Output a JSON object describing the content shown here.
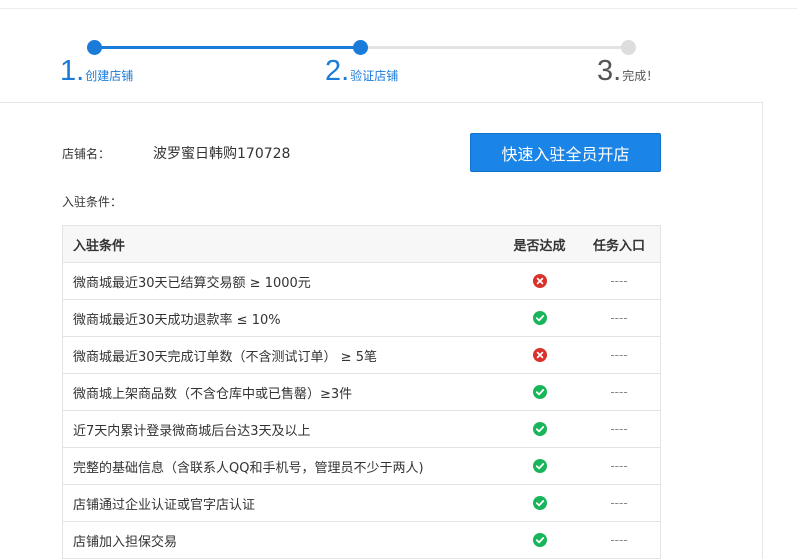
{
  "stepper": {
    "steps": [
      {
        "number": "1.",
        "label": "创建店铺",
        "state": "done"
      },
      {
        "number": "2.",
        "label": "验证店铺",
        "state": "current"
      },
      {
        "number": "3.",
        "label": "完成！",
        "state": "pending"
      }
    ]
  },
  "shop": {
    "name_label": "店铺名：",
    "name_value": "波罗蜜日韩购170728"
  },
  "open_button": {
    "label": "快速入驻全员开店"
  },
  "conditions": {
    "caption": "入驻条件：",
    "columns": [
      "入驻条件",
      "是否达成",
      "任务入口"
    ],
    "rows": [
      {
        "condition": "微商城最近30天已结算交易额 ≥ 1000元",
        "met": false,
        "status_icon": "x-circle-icon",
        "entry": "----"
      },
      {
        "condition": "微商城最近30天成功退款率 ≤ 10%",
        "met": true,
        "status_icon": "check-circle-icon",
        "entry": "----"
      },
      {
        "condition": "微商城最近30天完成订单数（不含测试订单） ≥ 5笔",
        "met": false,
        "status_icon": "x-circle-icon",
        "entry": "----"
      },
      {
        "condition": "微商城上架商品数（不含仓库中或已售罄）≥3件",
        "met": true,
        "status_icon": "check-circle-icon",
        "entry": "----"
      },
      {
        "condition": "近7天内累计登录微商城后台达3天及以上",
        "met": true,
        "status_icon": "check-circle-icon",
        "entry": "----"
      },
      {
        "condition": "完整的基础信息（含联系人QQ和手机号，管理员不少于两人)",
        "met": true,
        "status_icon": "check-circle-icon",
        "entry": "----"
      },
      {
        "condition": "店铺通过企业认证或官字店认证",
        "met": true,
        "status_icon": "check-circle-icon",
        "entry": "----"
      },
      {
        "condition": "店铺加入担保交易",
        "met": true,
        "status_icon": "check-circle-icon",
        "entry": "----"
      }
    ]
  },
  "colors": {
    "accent": "#1a7bd9",
    "button": "#1a85e6",
    "success": "#19b55a",
    "fail": "#d9322b",
    "inactive_step": "#dddddd"
  }
}
